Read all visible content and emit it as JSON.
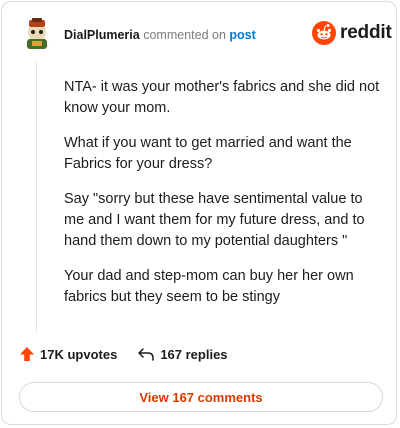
{
  "header": {
    "username": "DialPlumeria",
    "commented_on": "commented on",
    "post_link": "post"
  },
  "brand": {
    "wordmark": "reddit",
    "color": "#ff4500"
  },
  "comment": {
    "paragraphs": [
      "NTA- it was your mother's fabrics and she did not know your mom.",
      "What if you want to get married and want the Fabrics for your dress?",
      "Say \"sorry but these have sentimental value to me and I want them for my future dress, and to hand them down to my potential daughters \"",
      "Your dad and step-mom can buy her her own fabrics but they seem to be stingy"
    ]
  },
  "actions": {
    "upvotes": "17K upvotes",
    "replies": "167 replies",
    "upvote_icon": "upvote-arrow-icon",
    "reply_icon": "reply-arrow-icon",
    "upvote_color": "#ff4500"
  },
  "footer": {
    "view_comments": "View 167 comments",
    "accent": "#d93a00"
  }
}
